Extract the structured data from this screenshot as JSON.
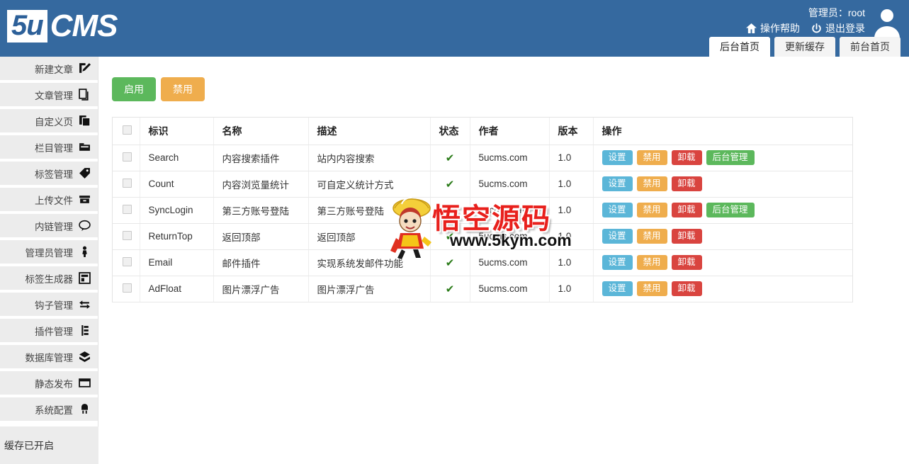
{
  "header": {
    "logo_box": "5u",
    "logo_text": "CMS",
    "admin_label": "管理员：root",
    "links": [
      {
        "label": "操作帮助",
        "icon": "home-icon"
      },
      {
        "label": "退出登录",
        "icon": "power-icon"
      }
    ],
    "tabs": [
      {
        "label": "后台首页",
        "active": true
      },
      {
        "label": "更新缓存",
        "active": false
      },
      {
        "label": "前台首页",
        "active": false
      }
    ]
  },
  "sidebar": {
    "items": [
      {
        "label": "新建文章",
        "icon": "edit-document-icon"
      },
      {
        "label": "文章管理",
        "icon": "documents-icon"
      },
      {
        "label": "自定义页",
        "icon": "copy-page-icon"
      },
      {
        "label": "栏目管理",
        "icon": "folder-icon"
      },
      {
        "label": "标签管理",
        "icon": "tag-icon"
      },
      {
        "label": "上传文件",
        "icon": "archive-icon"
      },
      {
        "label": "内链管理",
        "icon": "comment-icon"
      },
      {
        "label": "管理员管理",
        "icon": "person-icon"
      },
      {
        "label": "标签生成器",
        "icon": "layout-icon"
      },
      {
        "label": "钩子管理",
        "icon": "exchange-icon"
      },
      {
        "label": "插件管理",
        "icon": "plugin-icon"
      },
      {
        "label": "数据库管理",
        "icon": "database-icon"
      },
      {
        "label": "静态发布",
        "icon": "window-icon"
      },
      {
        "label": "系统配置",
        "icon": "plug-icon"
      }
    ],
    "cache_status": "缓存已开启"
  },
  "main": {
    "toolbar": {
      "enable_label": "启用",
      "disable_label": "禁用"
    },
    "table": {
      "columns": [
        "",
        "标识",
        "名称",
        "描述",
        "状态",
        "作者",
        "版本",
        "操作"
      ],
      "rows": [
        {
          "id": "Search",
          "name": "内容搜索插件",
          "desc": "站内内容搜索",
          "state": "✔",
          "author": "5ucms.com",
          "version": "1.0",
          "ops": [
            "设置",
            "禁用",
            "卸载",
            "后台管理"
          ]
        },
        {
          "id": "Count",
          "name": "内容浏览量统计",
          "desc": "可自定义统计方式",
          "state": "✔",
          "author": "5ucms.com",
          "version": "1.0",
          "ops": [
            "设置",
            "禁用",
            "卸载"
          ]
        },
        {
          "id": "SyncLogin",
          "name": "第三方账号登陆",
          "desc": "第三方账号登陆",
          "state": "✔",
          "author": "5ucms.com",
          "version": "1.0",
          "ops": [
            "设置",
            "禁用",
            "卸载",
            "后台管理"
          ]
        },
        {
          "id": "ReturnTop",
          "name": "返回顶部",
          "desc": "返回顶部",
          "state": "✔",
          "author": "5ucms.com",
          "version": "1.0",
          "ops": [
            "设置",
            "禁用",
            "卸载"
          ]
        },
        {
          "id": "Email",
          "name": "邮件插件",
          "desc": "实现系统发邮件功能",
          "state": "✔",
          "author": "5ucms.com",
          "version": "1.0",
          "ops": [
            "设置",
            "禁用",
            "卸载"
          ]
        },
        {
          "id": "AdFloat",
          "name": "图片漂浮广告",
          "desc": "图片漂浮广告",
          "state": "✔",
          "author": "5ucms.com",
          "version": "1.0",
          "ops": [
            "设置",
            "禁用",
            "卸载"
          ]
        }
      ]
    }
  },
  "watermark": {
    "text": "悟空源码",
    "url": "www.5kym.com"
  },
  "colors": {
    "header_blue": "#35699f",
    "green": "#5cb85c",
    "orange": "#efad4d",
    "red": "#d9443f",
    "blue": "#5bb6d8",
    "check_green": "#2a7b18",
    "watermark_red": "#e8201c"
  }
}
